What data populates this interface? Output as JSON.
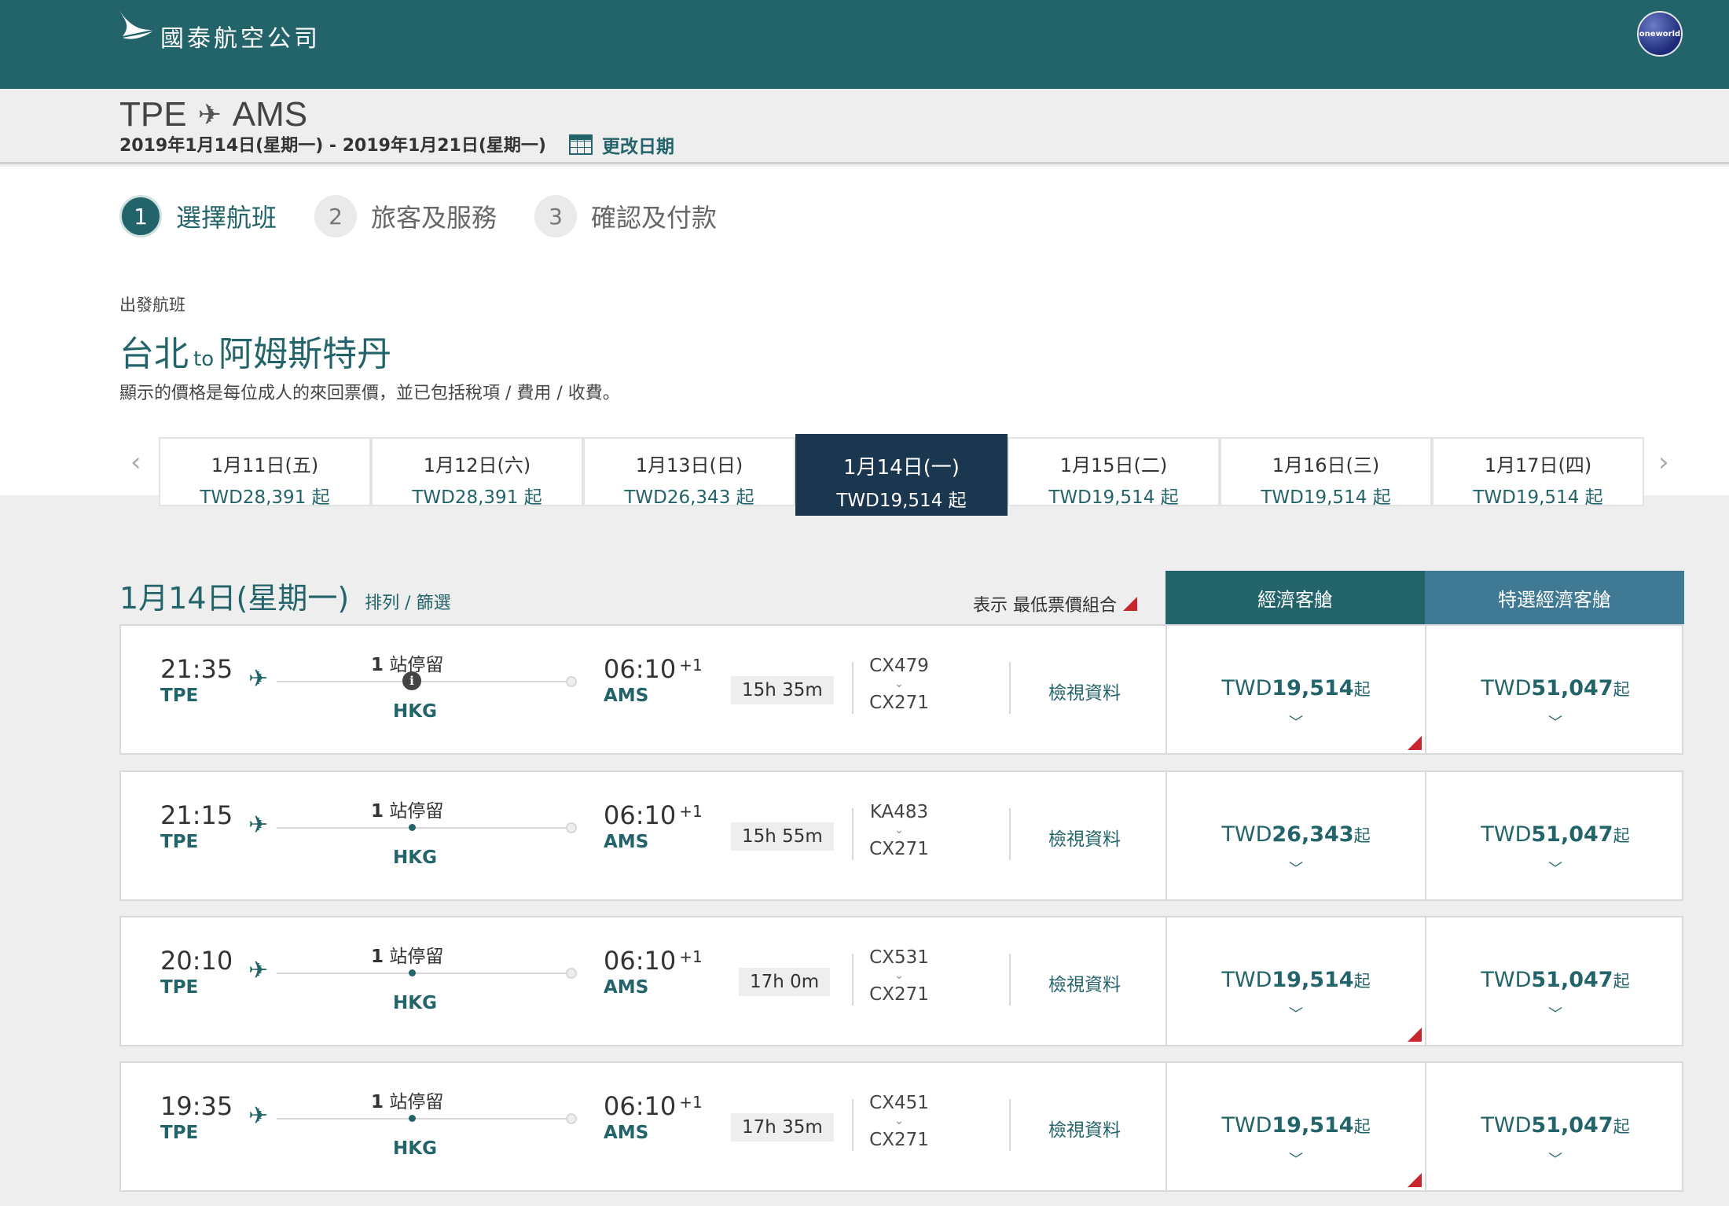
{
  "header": {
    "brand": "國泰航空公司",
    "alliance": "oneworld"
  },
  "route": {
    "origin": "TPE",
    "destination": "AMS",
    "dates": "2019年1月14日(星期一) - 2019年1月21日(星期一)",
    "change_date": "更改日期"
  },
  "steps": [
    {
      "num": "1",
      "label": "選擇航班"
    },
    {
      "num": "2",
      "label": "旅客及服務"
    },
    {
      "num": "3",
      "label": "確認及付款"
    }
  ],
  "departure": {
    "label": "出發航班",
    "from_city": "台北",
    "to_word": "to",
    "to_city": "阿姆斯特丹",
    "note": "顯示的價格是每位成人的來回票價，並已包括稅項 / 費用 / 收費。"
  },
  "date_strip": [
    {
      "date": "1月11日(五)",
      "price": "TWD28,391 起"
    },
    {
      "date": "1月12日(六)",
      "price": "TWD28,391 起"
    },
    {
      "date": "1月13日(日)",
      "price": "TWD26,343 起"
    },
    {
      "date": "1月14日(一)",
      "price": "TWD19,514 起"
    },
    {
      "date": "1月15日(二)",
      "price": "TWD19,514 起"
    },
    {
      "date": "1月16日(三)",
      "price": "TWD19,514 起"
    },
    {
      "date": "1月17日(四)",
      "price": "TWD19,514 起"
    }
  ],
  "results": {
    "date": "1月14日(星期一)",
    "sort_filter": "排列 / 篩選",
    "legend": "表示 最低票價組合",
    "cabin_economy": "經濟客艙",
    "cabin_premium": "特選經濟客艙"
  },
  "flights": [
    {
      "dep_time": "21:35",
      "dep_code": "TPE",
      "stops": "站停留",
      "stops_n": "1",
      "via": "HKG",
      "arr_time": "06:10",
      "arr_plus": "+1",
      "arr_code": "AMS",
      "duration": "15h 35m",
      "f1": "CX479",
      "f2": "CX271",
      "details": "檢視資料",
      "eco_cur": "TWD",
      "eco_amt": "19,514",
      "eco_suffix": "起",
      "prem_cur": "TWD",
      "prem_amt": "51,047",
      "prem_suffix": "起"
    },
    {
      "dep_time": "21:15",
      "dep_code": "TPE",
      "stops": "站停留",
      "stops_n": "1",
      "via": "HKG",
      "arr_time": "06:10",
      "arr_plus": "+1",
      "arr_code": "AMS",
      "duration": "15h 55m",
      "f1": "KA483",
      "f2": "CX271",
      "details": "檢視資料",
      "eco_cur": "TWD",
      "eco_amt": "26,343",
      "eco_suffix": "起",
      "prem_cur": "TWD",
      "prem_amt": "51,047",
      "prem_suffix": "起"
    },
    {
      "dep_time": "20:10",
      "dep_code": "TPE",
      "stops": "站停留",
      "stops_n": "1",
      "via": "HKG",
      "arr_time": "06:10",
      "arr_plus": "+1",
      "arr_code": "AMS",
      "duration": "17h 0m",
      "f1": "CX531",
      "f2": "CX271",
      "details": "檢視資料",
      "eco_cur": "TWD",
      "eco_amt": "19,514",
      "eco_suffix": "起",
      "prem_cur": "TWD",
      "prem_amt": "51,047",
      "prem_suffix": "起"
    },
    {
      "dep_time": "19:35",
      "dep_code": "TPE",
      "stops": "站停留",
      "stops_n": "1",
      "via": "HKG",
      "arr_time": "06:10",
      "arr_plus": "+1",
      "arr_code": "AMS",
      "duration": "17h 35m",
      "f1": "CX451",
      "f2": "CX271",
      "details": "檢視資料",
      "eco_cur": "TWD",
      "eco_amt": "19,514",
      "eco_suffix": "起",
      "prem_cur": "TWD",
      "prem_amt": "51,047",
      "prem_suffix": "起"
    }
  ],
  "colors": {
    "brand": "#23646a",
    "active_date": "#1b3750",
    "premium": "#3f7993",
    "lowest_fare_marker": "#c8262f"
  }
}
